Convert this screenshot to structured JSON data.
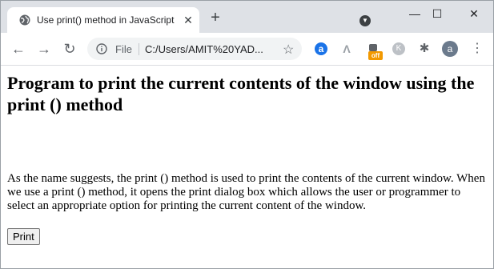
{
  "browser": {
    "tab": {
      "title": "Use print() method in JavaScript",
      "close_glyph": "✕"
    },
    "new_tab_glyph": "+",
    "window_controls": {
      "minimize": "—",
      "maximize": "☐",
      "close": "✕"
    },
    "toolbar": {
      "back_glyph": "←",
      "forward_glyph": "→",
      "reload_glyph": "↻",
      "site_info_label": "File",
      "url": "C:/Users/AMIT%20YAD...",
      "bookmark_glyph": "☆",
      "extensions": [
        {
          "name": "a-extension-icon",
          "glyph": "a"
        },
        {
          "name": "arrow-extension-icon",
          "glyph": "Λ"
        },
        {
          "name": "offer-extension-icon",
          "badge": "off"
        },
        {
          "name": "k-extension-icon",
          "glyph": "K"
        },
        {
          "name": "puzzle-icon",
          "glyph": "✱"
        }
      ],
      "profile_initial": "a",
      "menu_glyph": "⋮"
    }
  },
  "page": {
    "heading": "Program to print the current contents of the window using the print () method",
    "paragraph": "As the name suggests, the print () method is used to print the contents of the current window. When we use a print () method, it opens the print dialog box which allows the user or programmer to select an appropriate option for printing the current content of the window.",
    "print_button": "Print"
  },
  "colors": {
    "tabstrip": "#dee1e6",
    "omnibox": "#f1f3f4",
    "accent": "#1a73e8",
    "badge": "#f29900"
  }
}
